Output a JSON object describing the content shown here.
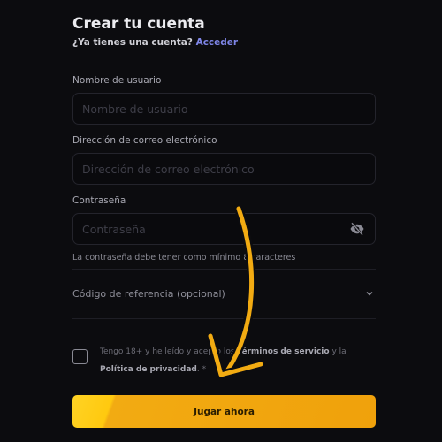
{
  "form": {
    "title": "Crear tu cuenta",
    "have_account": "¿Ya tienes una cuenta?",
    "login_link": "Acceder"
  },
  "fields": {
    "username": {
      "label": "Nombre de usuario",
      "placeholder": "Nombre de usuario"
    },
    "email": {
      "label": "Dirección de correo electrónico",
      "placeholder": "Dirección de correo electrónico"
    },
    "password": {
      "label": "Contraseña",
      "placeholder": "Contraseña",
      "hint": "La contraseña debe tener como mínimo 8 caracteres"
    }
  },
  "referral": {
    "label": "Código de referencia (opcional)"
  },
  "terms": {
    "text_before": "Tengo 18+ y he leído y acepto los ",
    "terms_link": "Términos de servicio",
    "text_mid": " y la ",
    "privacy_link": "Política de privacidad",
    "text_after": ". *"
  },
  "cta": {
    "label": "Jugar ahora"
  },
  "colors": {
    "background": "#0c0c0f",
    "link": "#7f86e8",
    "cta": "#f0a10b",
    "annotation_arrow": "#f2ab12"
  },
  "icons": {
    "password_toggle": "eye-slash-icon",
    "referral_expand": "chevron-down-icon",
    "annotation": "curved-arrow-icon"
  }
}
